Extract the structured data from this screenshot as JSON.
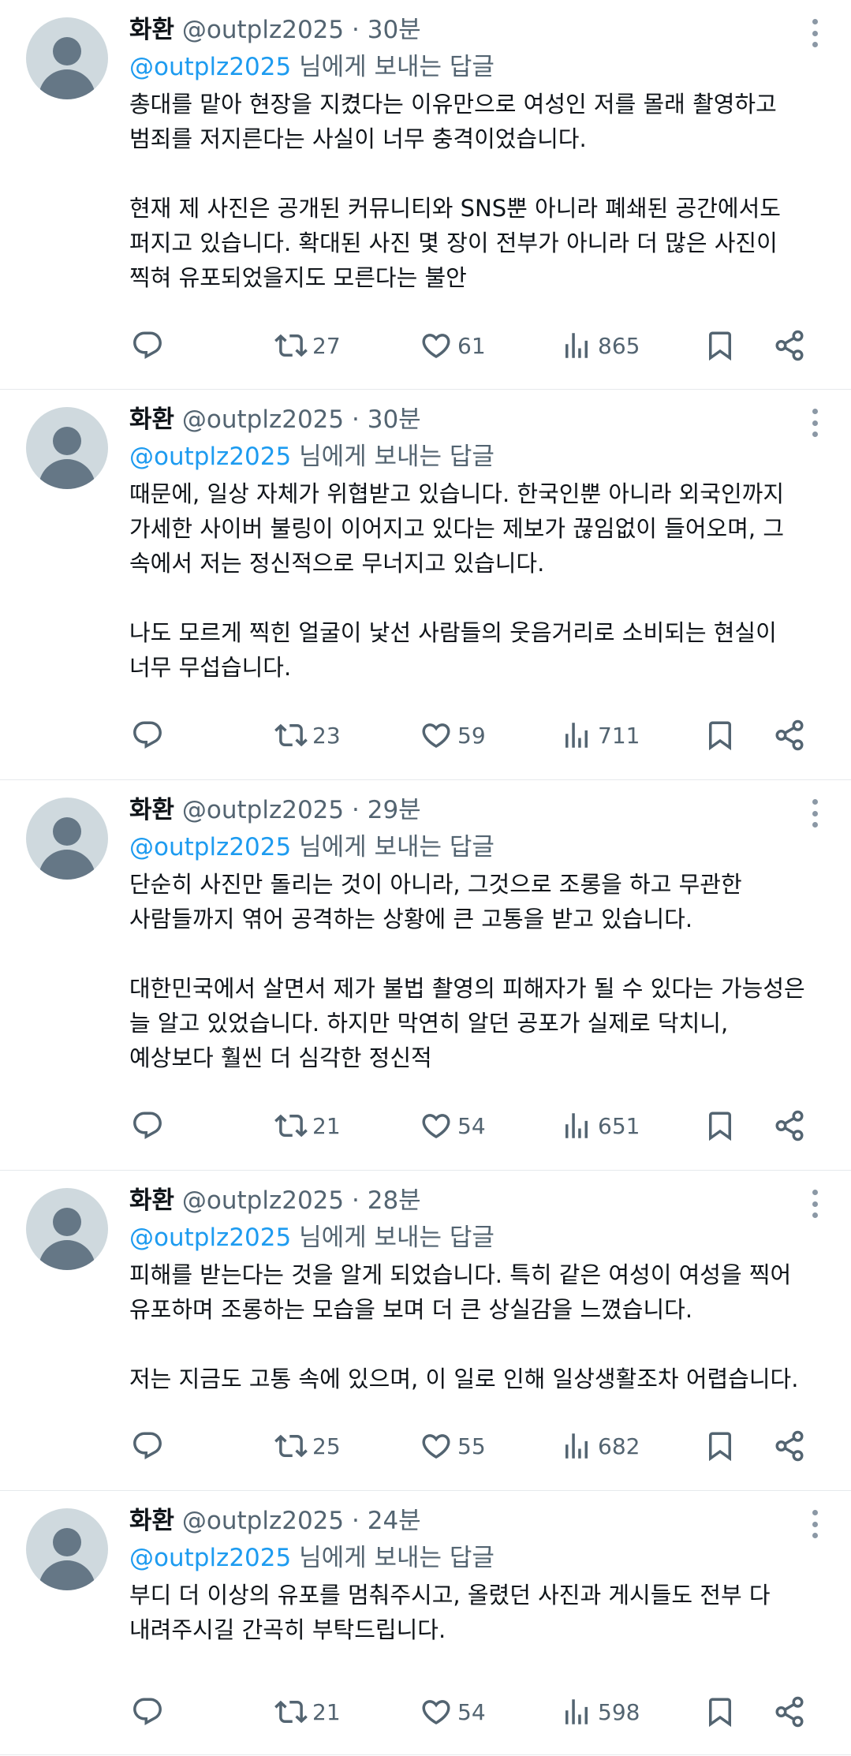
{
  "colors": {
    "accent": "#1d9bf0",
    "secondary": "#536471",
    "text": "#0f1419",
    "divider": "#e6e9ec"
  },
  "icons": [
    "reply-icon",
    "retweet-icon",
    "like-icon",
    "views-icon",
    "bookmark-icon",
    "share-icon",
    "more-icon"
  ],
  "tweets": [
    {
      "name": "화환",
      "handle": "@outplz2025",
      "dot": "·",
      "time": "30분",
      "reply_mention": "@outplz2025",
      "reply_suffix": " 님에게 보내는 답글",
      "lines": [
        "총대를 맡아 현장을 지켰다는 이유만으로 여성인 저를 몰래 촬영하고",
        "범죄를 저지른다는 사실이 너무 충격이었습니다.",
        "",
        "현재 제 사진은 공개된 커뮤니티와 SNS뿐 아니라 폐쇄된 공간에서도",
        "퍼지고 있습니다. 확대된 사진 몇 장이 전부가 아니라 더 많은 사진이",
        "찍혀 유포되었을지도 모른다는 불안"
      ],
      "retweets": "27",
      "likes": "61",
      "views": "865"
    },
    {
      "name": "화환",
      "handle": "@outplz2025",
      "dot": "·",
      "time": "30분",
      "reply_mention": "@outplz2025",
      "reply_suffix": " 님에게 보내는 답글",
      "lines": [
        "때문에, 일상 자체가 위협받고 있습니다. 한국인뿐 아니라 외국인까지",
        "가세한 사이버 불링이 이어지고 있다는 제보가 끊임없이 들어오며, 그",
        "속에서 저는 정신적으로 무너지고 있습니다.",
        "",
        "나도 모르게 찍힌 얼굴이 낯선 사람들의 웃음거리로 소비되는 현실이",
        "너무 무섭습니다."
      ],
      "retweets": "23",
      "likes": "59",
      "views": "711"
    },
    {
      "name": "화환",
      "handle": "@outplz2025",
      "dot": "·",
      "time": "29분",
      "reply_mention": "@outplz2025",
      "reply_suffix": " 님에게 보내는 답글",
      "lines": [
        "단순히 사진만 돌리는 것이 아니라, 그것으로 조롱을 하고 무관한",
        "사람들까지 엮어 공격하는 상황에 큰 고통을 받고 있습니다.",
        "",
        "대한민국에서 살면서 제가 불법 촬영의 피해자가 될 수 있다는 가능성은",
        "늘 알고 있었습니다. 하지만 막연히 알던 공포가 실제로 닥치니,",
        "예상보다 훨씬 더 심각한 정신적"
      ],
      "retweets": "21",
      "likes": "54",
      "views": "651"
    },
    {
      "name": "화환",
      "handle": "@outplz2025",
      "dot": "·",
      "time": "28분",
      "reply_mention": "@outplz2025",
      "reply_suffix": " 님에게 보내는 답글",
      "lines": [
        "피해를 받는다는 것을 알게 되었습니다. 특히 같은 여성이 여성을 찍어",
        "유포하며 조롱하는 모습을 보며 더 큰 상실감을 느꼈습니다.",
        "",
        "저는 지금도 고통 속에 있으며, 이 일로 인해 일상생활조차 어렵습니다."
      ],
      "retweets": "25",
      "likes": "55",
      "views": "682"
    },
    {
      "name": "화환",
      "handle": "@outplz2025",
      "dot": "·",
      "time": "24분",
      "reply_mention": "@outplz2025",
      "reply_suffix": " 님에게 보내는 답글",
      "lines": [
        "부디 더 이상의 유포를 멈춰주시고, 올렸던 사진과 게시들도 전부 다",
        "내려주시길 간곡히 부탁드립니다."
      ],
      "retweets": "21",
      "likes": "54",
      "views": "598"
    }
  ]
}
